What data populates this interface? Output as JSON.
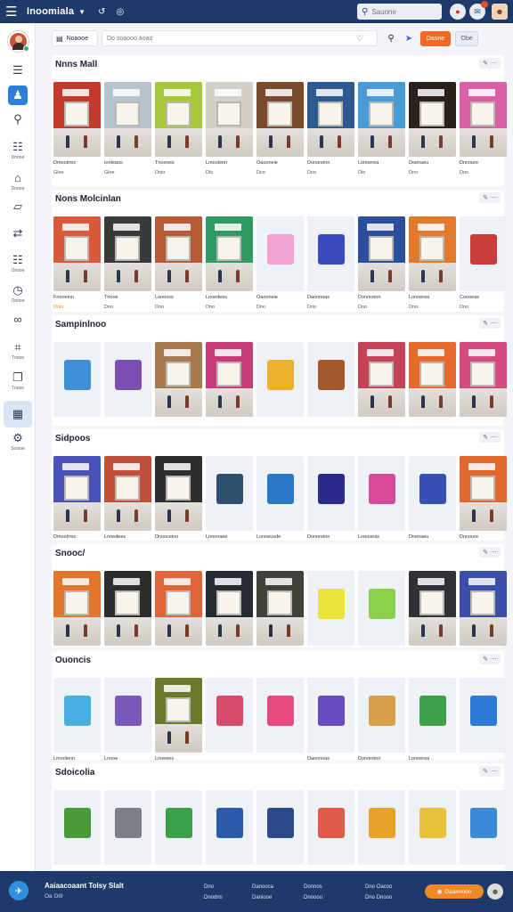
{
  "topbar": {
    "app_title": "Inoomiala",
    "search_placeholder": "Sauone"
  },
  "search": {
    "filter_label": "Noaooe",
    "placeholder": "Do soaooo aoao",
    "go_label": "Dasne",
    "alt_label": "Obe"
  },
  "sidebar": {
    "items": [
      {
        "label": "",
        "icon": "menu-icon"
      },
      {
        "label": "",
        "icon": "store-icon"
      },
      {
        "label": "",
        "icon": "search-icon"
      },
      {
        "label": "Dnooe",
        "icon": "document-icon"
      },
      {
        "label": "Dnooe",
        "icon": "bag-icon"
      },
      {
        "label": "",
        "icon": "map-icon"
      },
      {
        "label": "",
        "icon": "share-icon"
      },
      {
        "label": "Onooe",
        "icon": "chart-icon"
      },
      {
        "label": "Onooe",
        "icon": "clock-icon"
      },
      {
        "label": "",
        "icon": "link-icon"
      },
      {
        "label": "Tnooe",
        "icon": "calendar-icon"
      },
      {
        "label": "Tnooe",
        "icon": "lock-icon"
      },
      {
        "label": "",
        "icon": "grid-icon"
      },
      {
        "label": "Sooioe",
        "icon": "settings-icon"
      }
    ]
  },
  "sections": [
    {
      "title": "Nnns Mall",
      "cards": [
        {
          "l1": "Dmooirms",
          "l2": "Gloe",
          "c": "#c23a2d",
          "t": "store"
        },
        {
          "l1": "Ionleaos",
          "l2": "Gloe",
          "c": "#b7c3cf",
          "t": "store"
        },
        {
          "l1": "Tnooreio",
          "l2": "Dnio",
          "c": "#a7c63a",
          "t": "store"
        },
        {
          "l1": "Lmoolenn",
          "l2": "Dlo",
          "c": "#d2cfc8",
          "t": "store"
        },
        {
          "l1": "Oaooneie",
          "l2": "Dco",
          "c": "#7a4a2c",
          "t": "store"
        },
        {
          "l1": "Donoreinn",
          "l2": "Dno",
          "c": "#2d5a8e",
          "t": "store"
        },
        {
          "l1": "Lonoerea",
          "l2": "Dlo",
          "c": "#4a9ad6",
          "t": "store"
        },
        {
          "l1": "Doenaeu",
          "l2": "Dno",
          "c": "#2a211d",
          "t": "store"
        },
        {
          "l1": "Dnnoure",
          "l2": "Dno",
          "c": "#d85fa6",
          "t": "store"
        }
      ]
    },
    {
      "title": "Nons Molcinlan",
      "cards": [
        {
          "l1": "Fnooeinn",
          "l2": "Dnio",
          "c": "#d85a3a",
          "t": "store",
          "hi": true
        },
        {
          "l1": "Tnooe",
          "l2": "Dno",
          "c": "#3a3a3a",
          "t": "store"
        },
        {
          "l1": "Lonooss",
          "l2": "Dno",
          "c": "#b85a35",
          "t": "store"
        },
        {
          "l1": "Lnoedees",
          "l2": "Dno",
          "c": "#2f9a62",
          "t": "store"
        },
        {
          "l1": "Oaooneie",
          "l2": "Dno",
          "c": "#f3a3d0",
          "t": "kiosk"
        },
        {
          "l1": "Daoonnas",
          "l2": "Dno",
          "c": "#3a4cc0",
          "t": "kiosk"
        },
        {
          "l1": "Donoreinn",
          "l2": "Dno",
          "c": "#2d4f9a",
          "t": "store"
        },
        {
          "l1": "Lonoerea",
          "l2": "Dno",
          "c": "#e27a2e",
          "t": "store"
        },
        {
          "l1": "Coooeas",
          "l2": "Dno",
          "c": "#c83c3c",
          "t": "kiosk"
        }
      ]
    },
    {
      "title": "Sampinlnoo",
      "cards": [
        {
          "l1": "",
          "l2": "",
          "c": "#3d8fd6",
          "t": "kiosk"
        },
        {
          "l1": "",
          "l2": "",
          "c": "#7c4fb5",
          "t": "kiosk"
        },
        {
          "l1": "",
          "l2": "",
          "c": "#a97a4e",
          "t": "store"
        },
        {
          "l1": "",
          "l2": "",
          "c": "#c73c78",
          "t": "store"
        },
        {
          "l1": "",
          "l2": "",
          "c": "#e9b22a",
          "t": "kiosk"
        },
        {
          "l1": "",
          "l2": "",
          "c": "#a35a2c",
          "t": "kiosk"
        },
        {
          "l1": "",
          "l2": "",
          "c": "#c64257",
          "t": "store"
        },
        {
          "l1": "",
          "l2": "",
          "c": "#e76a2a",
          "t": "store"
        },
        {
          "l1": "",
          "l2": "",
          "c": "#d24a7e",
          "t": "store"
        }
      ]
    },
    {
      "title": "Sidpoos",
      "cards": [
        {
          "l1": "Dmooirms",
          "l2": "Dno",
          "c": "#4a52b8",
          "t": "store",
          "hi": true
        },
        {
          "l1": "Lnoedees",
          "l2": "Dno",
          "c": "#c0503a",
          "t": "store"
        },
        {
          "l1": "Dnooceino",
          "l2": "Dno",
          "c": "#2e2e2e",
          "t": "store"
        },
        {
          "l1": "Lnoonaee",
          "l2": "Dno",
          "c": "#2f4f6f",
          "t": "kiosk"
        },
        {
          "l1": "Lonoeusde",
          "l2": "Dno",
          "c": "#2a78c8",
          "t": "kiosk"
        },
        {
          "l1": "Donoreinn",
          "l2": "Dno",
          "c": "#2a2a8a",
          "t": "kiosk"
        },
        {
          "l1": "Loooueas",
          "l2": "Dno",
          "c": "#d84a9a",
          "t": "kiosk"
        },
        {
          "l1": "Doenaeu",
          "l2": "Dno",
          "c": "#3750b5",
          "t": "kiosk"
        },
        {
          "l1": "Dnnoure",
          "l2": "Dno",
          "c": "#e0682e",
          "t": "store"
        }
      ]
    },
    {
      "title": "Snooc/",
      "cards": [
        {
          "l1": "",
          "l2": "",
          "c": "#e2772c",
          "t": "store"
        },
        {
          "l1": "",
          "l2": "",
          "c": "#2d2d2d",
          "t": "store"
        },
        {
          "l1": "",
          "l2": "",
          "c": "#e0663a",
          "t": "store"
        },
        {
          "l1": "",
          "l2": "",
          "c": "#262a33",
          "t": "store"
        },
        {
          "l1": "",
          "l2": "",
          "c": "#40423a",
          "t": "store"
        },
        {
          "l1": "",
          "l2": "",
          "c": "#e8e23a",
          "t": "kiosk"
        },
        {
          "l1": "",
          "l2": "",
          "c": "#8bd04a",
          "t": "kiosk"
        },
        {
          "l1": "",
          "l2": "",
          "c": "#2f3136",
          "t": "store"
        },
        {
          "l1": "",
          "l2": "",
          "c": "#3b4fa8",
          "t": "store"
        }
      ]
    },
    {
      "title": "Ouoncis",
      "cards": [
        {
          "l1": "Lmoolenn",
          "l2": "Dno",
          "c": "#48b0e0",
          "t": "kiosk",
          "hi": true
        },
        {
          "l1": "Lnooe",
          "l2": "Dno",
          "c": "#7a5ab8",
          "t": "kiosk"
        },
        {
          "l1": "Lnoeees",
          "l2": "Dno",
          "c": "#6b7a2a",
          "t": "store"
        },
        {
          "l1": "",
          "l2": "",
          "c": "#d84a6a",
          "t": "kiosk"
        },
        {
          "l1": "",
          "l2": "",
          "c": "#e84a80",
          "t": "kiosk"
        },
        {
          "l1": "Daoonnas",
          "l2": "Dno",
          "c": "#6a4ac0",
          "t": "kiosk"
        },
        {
          "l1": "Donoreinn",
          "l2": "Dno",
          "c": "#d8a04a",
          "t": "kiosk"
        },
        {
          "l1": "Lonoerea",
          "l2": "Dno",
          "c": "#3da04a",
          "t": "kiosk"
        },
        {
          "l1": "",
          "l2": "",
          "c": "#2d7ad8",
          "t": "kiosk"
        }
      ]
    },
    {
      "title": "Sdoicolia",
      "cards": [
        {
          "l1": "",
          "l2": "",
          "c": "#4a9a3a",
          "t": "kiosk"
        },
        {
          "l1": "",
          "l2": "",
          "c": "#7a7f88",
          "t": "kiosk"
        },
        {
          "l1": "",
          "l2": "",
          "c": "#3aa04a",
          "t": "kiosk"
        },
        {
          "l1": "",
          "l2": "",
          "c": "#2a5aa8",
          "t": "kiosk"
        },
        {
          "l1": "",
          "l2": "",
          "c": "#2d4a8a",
          "t": "kiosk"
        },
        {
          "l1": "",
          "l2": "",
          "c": "#e05a4a",
          "t": "kiosk"
        },
        {
          "l1": "",
          "l2": "",
          "c": "#e8a22a",
          "t": "kiosk"
        },
        {
          "l1": "",
          "l2": "",
          "c": "#e8c23a",
          "t": "kiosk"
        },
        {
          "l1": "",
          "l2": "",
          "c": "#3a8ad8",
          "t": "kiosk"
        }
      ]
    }
  ],
  "footer": {
    "brand": "Aaiaacoaant Tolsy Slalt",
    "sub": "Oa Oi9",
    "cols": [
      {
        "a": "Dno",
        "b": "Dnodns"
      },
      {
        "a": "Danooca",
        "b": "Daniooe"
      },
      {
        "a": "Donnos",
        "b": "Dnooou"
      },
      {
        "a": "Dno Oacoo",
        "b": "Dno  Dnooo"
      }
    ],
    "button": "Daaeooon"
  }
}
